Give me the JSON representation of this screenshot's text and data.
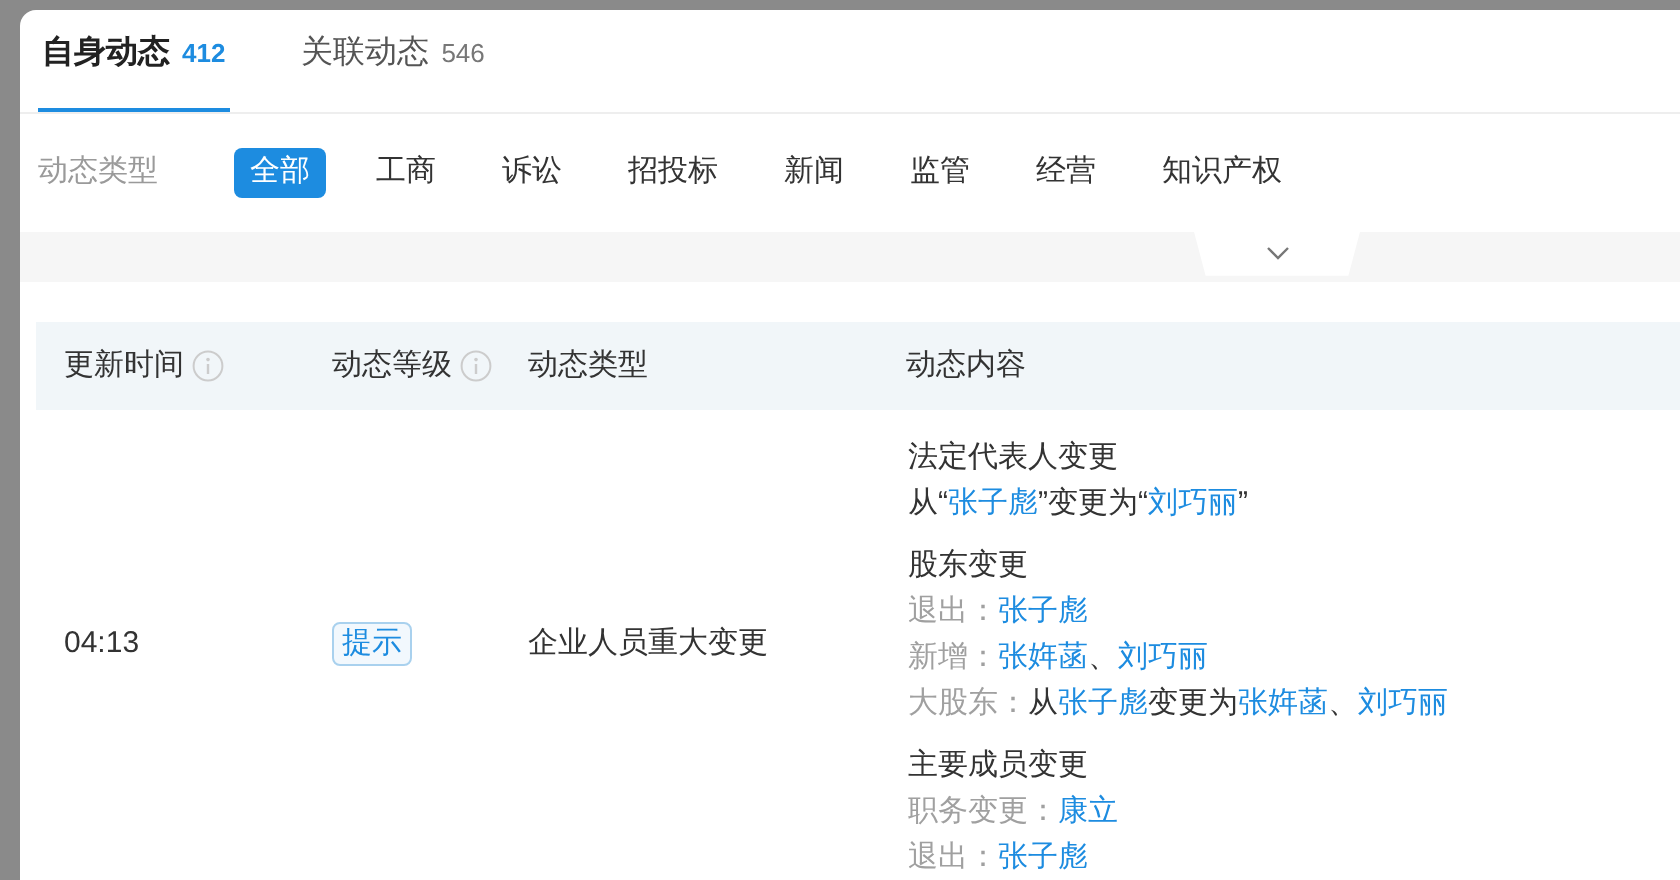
{
  "tabs": [
    {
      "label": "自身动态",
      "count": "412",
      "selected": true
    },
    {
      "label": "关联动态",
      "count": "546",
      "selected": false
    }
  ],
  "filter": {
    "label": "动态类型",
    "options": [
      {
        "label": "全部",
        "selected": true
      },
      {
        "label": "工商",
        "selected": false
      },
      {
        "label": "诉讼",
        "selected": false
      },
      {
        "label": "招投标",
        "selected": false
      },
      {
        "label": "新闻",
        "selected": false
      },
      {
        "label": "监管",
        "selected": false
      },
      {
        "label": "经营",
        "selected": false
      },
      {
        "label": "知识产权",
        "selected": false
      }
    ]
  },
  "table": {
    "columns": [
      {
        "label": "更新时间",
        "info": true
      },
      {
        "label": "动态等级",
        "info": true
      },
      {
        "label": "动态类型",
        "info": false
      },
      {
        "label": "动态内容",
        "info": false
      }
    ],
    "rows": [
      {
        "time": "04:13",
        "level": "提示",
        "type": "企业人员重大变更",
        "content": [
          {
            "title": "法定代表人变更",
            "lines": [
              {
                "parts": [
                  {
                    "text": "从“",
                    "link": false
                  },
                  {
                    "text": "张子彪",
                    "link": true
                  },
                  {
                    "text": "”变更为“",
                    "link": false
                  },
                  {
                    "text": "刘巧丽",
                    "link": true
                  },
                  {
                    "text": "”",
                    "link": false
                  }
                ]
              }
            ]
          },
          {
            "title": "股东变更",
            "lines": [
              {
                "label": "退出：",
                "parts": [
                  {
                    "text": "张子彪",
                    "link": true
                  }
                ]
              },
              {
                "label": "新增：",
                "parts": [
                  {
                    "text": "张姩菡",
                    "link": true
                  },
                  {
                    "text": "、",
                    "link": false
                  },
                  {
                    "text": "刘巧丽",
                    "link": true
                  }
                ]
              },
              {
                "label": "大股东：",
                "parts": [
                  {
                    "text": "从",
                    "link": false
                  },
                  {
                    "text": "张子彪",
                    "link": true
                  },
                  {
                    "text": "变更为",
                    "link": false
                  },
                  {
                    "text": "张姩菡",
                    "link": true
                  },
                  {
                    "text": "、",
                    "link": false
                  },
                  {
                    "text": "刘巧丽",
                    "link": true
                  }
                ]
              }
            ]
          },
          {
            "title": "主要成员变更",
            "lines": [
              {
                "label": "职务变更：",
                "parts": [
                  {
                    "text": "康立",
                    "link": true
                  }
                ]
              },
              {
                "label": "退出：",
                "parts": [
                  {
                    "text": "张子彪",
                    "link": true
                  }
                ]
              }
            ]
          }
        ]
      }
    ]
  }
}
